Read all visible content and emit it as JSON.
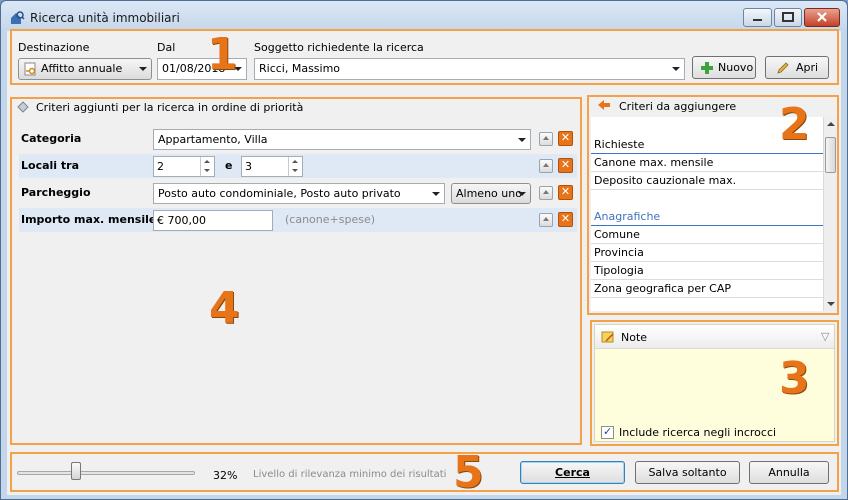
{
  "window": {
    "title": "Ricerca unità immobiliari",
    "controls": {
      "min": "_",
      "max": "▫",
      "close": "✕"
    }
  },
  "top": {
    "destinazione": {
      "label": "Destinazione",
      "value": "Affitto annuale"
    },
    "dal": {
      "label": "Dal",
      "value": "01/08/2018"
    },
    "soggetto": {
      "label": "Soggetto richiedente la ricerca",
      "value": "Ricci, Massimo"
    },
    "nuovo_label": "Nuovo",
    "apri_label": "Apri"
  },
  "criteria": {
    "header": "Criteri aggiunti per la ricerca in ordine di priorità",
    "rows": [
      {
        "label": "Categoria",
        "value": "Appartamento, Villa"
      },
      {
        "label": "Locali tra",
        "from": "2",
        "conj": "e",
        "to": "3"
      },
      {
        "label": "Parcheggio",
        "value": "Posto auto condominiale, Posto auto privato",
        "mode": "Almeno uno"
      },
      {
        "label": "Importo max. mensile",
        "value": "€ 700,00",
        "hint": "(canone+spese)"
      }
    ]
  },
  "available": {
    "header": "Criteri da aggiungere",
    "groups": [
      {
        "title": "Richieste",
        "items": [
          "Canone max. mensile",
          "Deposito cauzionale max."
        ]
      },
      {
        "title": "Anagrafiche",
        "items": [
          "Comune",
          "Provincia",
          "Tipologia",
          "Zona geografica per CAP"
        ]
      }
    ]
  },
  "note": {
    "header": "Note",
    "collapse_icon": "▽",
    "checkbox_label": "Include ricerca negli incrocci",
    "checkbox_checked": true
  },
  "bottom": {
    "slider_value": 32,
    "slider_text": "32%",
    "slider_label": "Livello di rilevanza minimo dei risultati",
    "cerca_label": "Cerca",
    "salva_label": "Salva soltanto",
    "annulla_label": "Annulla"
  },
  "markers": [
    "1",
    "2",
    "3",
    "4",
    "5"
  ],
  "colors": {
    "accent_orange": "#e8741a",
    "note_bg": "#fefedd",
    "row_highlight": "#dfe8f5",
    "group_blue": "#3e73c0"
  },
  "icons": {
    "plus": "+",
    "pencil": "✎",
    "delete": "✕",
    "check": "✓"
  }
}
